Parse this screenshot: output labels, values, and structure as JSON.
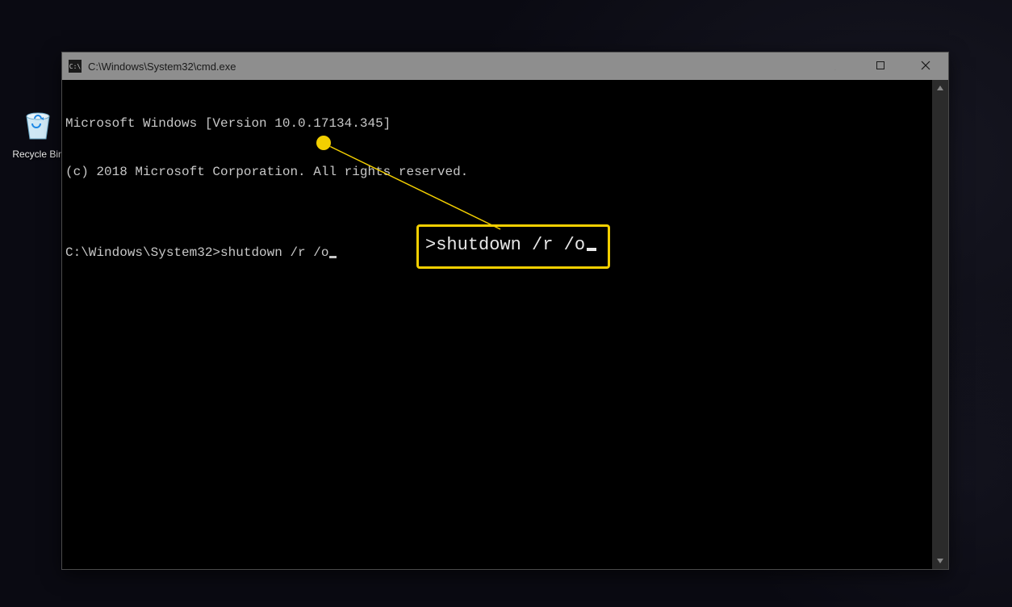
{
  "desktop": {
    "recycle_bin_label": "Recycle Bin"
  },
  "window": {
    "title": "C:\\Windows\\System32\\cmd.exe",
    "icon_text": "C:\\",
    "terminal": {
      "line1": "Microsoft Windows [Version 10.0.17134.345]",
      "line2": "(c) 2018 Microsoft Corporation. All rights reserved.",
      "blank": "",
      "prompt": "C:\\Windows\\System32>",
      "command": "shutdown /r /o"
    }
  },
  "callout": {
    "text": ">shutdown /r /o"
  }
}
